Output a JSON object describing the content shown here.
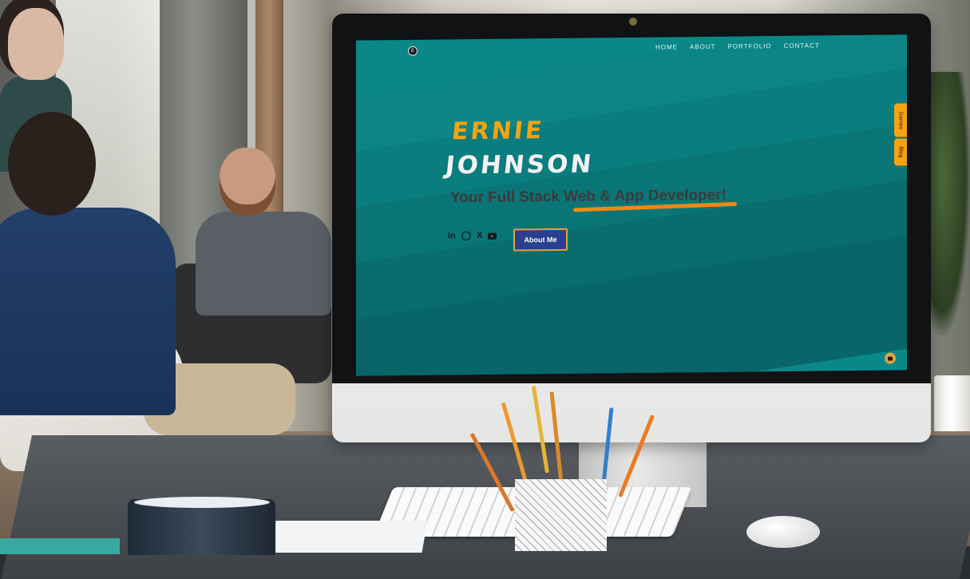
{
  "website": {
    "logo_glyph": "E",
    "nav": [
      "HOME",
      "ABOUT",
      "PORTFOLIO",
      "CONTACT"
    ],
    "hero": {
      "first_name": "ERNIE",
      "last_name": "JOHNSON",
      "tagline": "Your Full Stack Web & App Developer!"
    },
    "socials": {
      "linkedin": "in",
      "github": "◯",
      "x": "X"
    },
    "about_button": "About Me",
    "side_tabs": {
      "games": "Games",
      "blog": "Blog"
    },
    "colors": {
      "background": "#0a8888",
      "accent_orange": "#f5a312",
      "button_blue": "#2a3f8f",
      "underline": "#ee8a12"
    }
  }
}
